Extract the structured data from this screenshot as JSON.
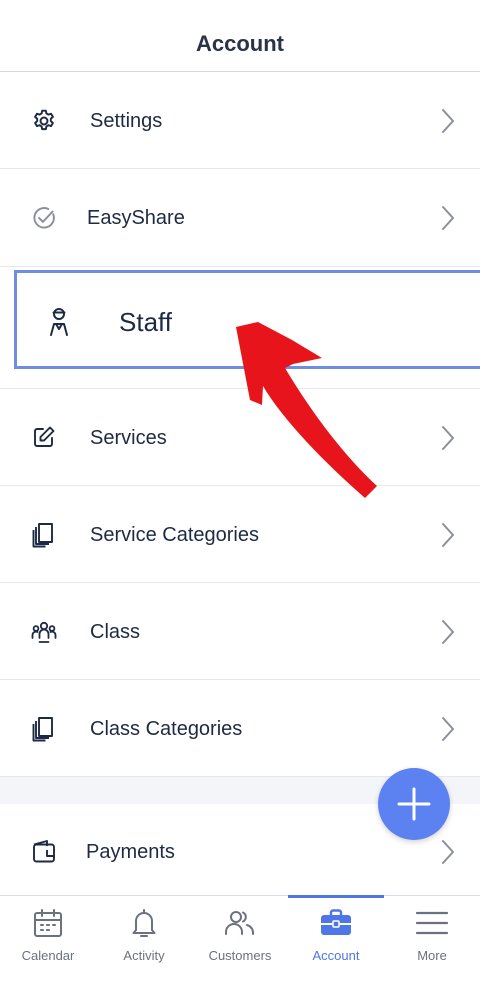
{
  "header": {
    "title": "Account"
  },
  "menu": {
    "settings": "Settings",
    "easyshare": "EasyShare",
    "staff": "Staff",
    "services": "Services",
    "service_categories": "Service Categories",
    "class": "Class",
    "class_categories": "Class Categories",
    "payments": "Payments"
  },
  "fab": {
    "icon": "plus-icon"
  },
  "tabbar": {
    "tabs": [
      {
        "label": "Calendar",
        "icon": "calendar-icon"
      },
      {
        "label": "Activity",
        "icon": "bell-icon"
      },
      {
        "label": "Customers",
        "icon": "users-icon"
      },
      {
        "label": "Account",
        "icon": "briefcase-icon",
        "active": true
      },
      {
        "label": "More",
        "icon": "menu-icon"
      }
    ]
  },
  "colors": {
    "accent": "#4f76e6",
    "fab": "#5b82f0",
    "highlight_border": "#6e8ee6",
    "annotation_arrow": "#e8141b",
    "text": "#1e2a44"
  }
}
